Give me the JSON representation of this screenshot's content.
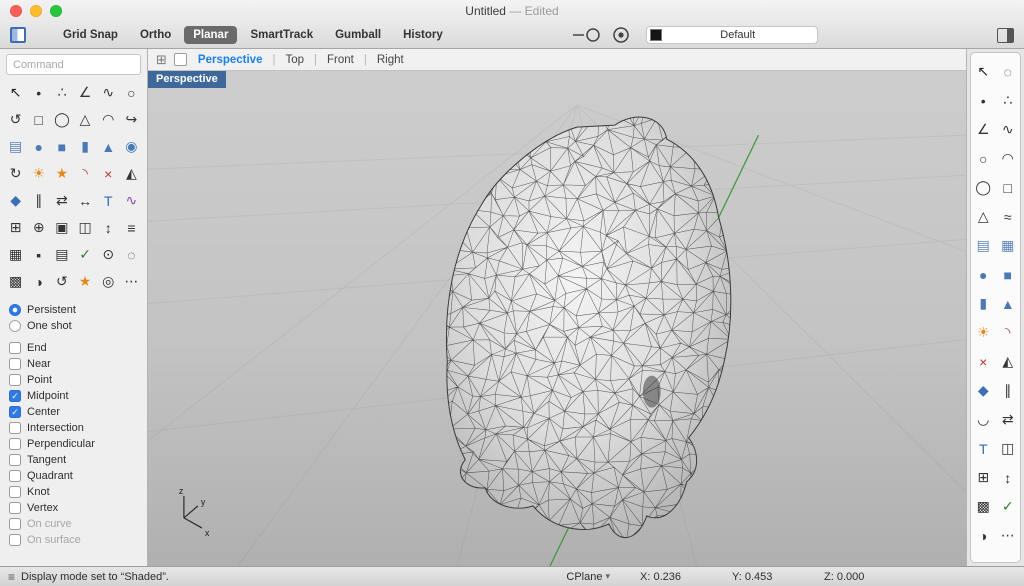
{
  "window": {
    "title": "Untitled",
    "edited": "— Edited",
    "traffic_colors": {
      "close": "#ff5f57",
      "minimize": "#febc2e",
      "zoom": "#2ac53e"
    }
  },
  "toolbar": {
    "buttons": [
      {
        "label": "Grid Snap",
        "active": false
      },
      {
        "label": "Ortho",
        "active": false
      },
      {
        "label": "Planar",
        "active": true
      },
      {
        "label": "SmartTrack",
        "active": false
      },
      {
        "label": "Gumball",
        "active": false
      },
      {
        "label": "History",
        "active": false
      }
    ],
    "widget_icons": [
      "osnap-widget-icon",
      "record-history-icon"
    ],
    "layer": {
      "name": "Default",
      "swatch_color": "#151515"
    }
  },
  "viewport_tabs": [
    {
      "label": "Perspective",
      "active": true
    },
    {
      "label": "Top",
      "active": false
    },
    {
      "label": "Front",
      "active": false
    },
    {
      "label": "Right",
      "active": false
    }
  ],
  "viewport": {
    "badge": "Perspective",
    "axis": {
      "x": "x",
      "y": "y",
      "z": "z"
    },
    "axis_line_color": "#3f9b3f",
    "mesh_stroke_color": "#2b2b2b"
  },
  "left_panel": {
    "command_placeholder": "Command",
    "tool_icons": [
      [
        "pointer-icon",
        "↖",
        "#222222"
      ],
      [
        "point-icon",
        "•",
        "#333333"
      ],
      [
        "points-icon",
        "∴",
        "#333333"
      ],
      [
        "polyline-icon",
        "∠",
        "#333333"
      ],
      [
        "curve-icon",
        "∿",
        "#333333"
      ],
      [
        "circle-icon",
        "○",
        "#333333"
      ],
      [
        "orbit-icon",
        "↺",
        "#333333"
      ],
      [
        "rectangle-icon",
        "□",
        "#333333"
      ],
      [
        "ellipse-icon",
        "◯",
        "#333333"
      ],
      [
        "polygon-icon",
        "△",
        "#333333"
      ],
      [
        "arc-icon",
        "◠",
        "#333333"
      ],
      [
        "extend-icon",
        "↪",
        "#333333"
      ],
      [
        "surface-icon",
        "▤",
        "#5b82b8"
      ],
      [
        "sphere-icon",
        "●",
        "#4a7ab5"
      ],
      [
        "box-icon",
        "■",
        "#4a7ab5"
      ],
      [
        "cylinder-icon",
        "▮",
        "#4a7ab5"
      ],
      [
        "cone-icon",
        "▲",
        "#4a7ab5"
      ],
      [
        "tube-icon",
        "◉",
        "#4a7ab5"
      ],
      [
        "revolve-icon",
        "↻",
        "#333333"
      ],
      [
        "spark-icon",
        "☀",
        "#e08a1e"
      ],
      [
        "explode-icon",
        "★",
        "#e08a1e"
      ],
      [
        "fillet-icon",
        "◝",
        "#b03a2e"
      ],
      [
        "trim-icon",
        "×",
        "#b03a2e"
      ],
      [
        "split-icon",
        "◭",
        "#333333"
      ],
      [
        "droplet-icon",
        "◆",
        "#3a6fb5"
      ],
      [
        "offset-icon",
        "∥",
        "#333333"
      ],
      [
        "swap-icon",
        "⇄",
        "#333333"
      ],
      [
        "scale-icon",
        "↔",
        "#333333"
      ],
      [
        "text-icon",
        "T",
        "#2e6db4"
      ],
      [
        "flow-icon",
        "∿",
        "#8e44ad"
      ],
      [
        "array-icon",
        "⊞",
        "#333333"
      ],
      [
        "polar-array-icon",
        "⊕",
        "#333333"
      ],
      [
        "copy-icon",
        "▣",
        "#333333"
      ],
      [
        "mirror-icon",
        "◫",
        "#333333"
      ],
      [
        "move-icon",
        "↕",
        "#333333"
      ],
      [
        "align-icon",
        "≡",
        "#333333"
      ],
      [
        "group-icon",
        "▦",
        "#333333"
      ],
      [
        "lock-icon",
        "▪",
        "#333333"
      ],
      [
        "layers-icon",
        "▤",
        "#333333"
      ],
      [
        "check-icon",
        "✓",
        "#2d7d2d"
      ],
      [
        "zoom-icon",
        "⊙",
        "#333333"
      ],
      [
        "hide-icon",
        "◌",
        "#333333"
      ],
      [
        "mesh-icon",
        "▩",
        "#333333"
      ],
      [
        "shade-icon",
        "◑",
        "#333333"
      ],
      [
        "spin-icon",
        "↺",
        "#333333"
      ],
      [
        "spark2-icon",
        "★",
        "#e08a1e"
      ],
      [
        "search-icon",
        "◎",
        "#333333"
      ],
      [
        "more-icon",
        "⋯",
        "#333333"
      ]
    ],
    "osnap_radios": [
      {
        "label": "Persistent",
        "selected": true
      },
      {
        "label": "One shot",
        "selected": false
      }
    ],
    "osnap_checkboxes": [
      {
        "label": "End",
        "checked": false,
        "disabled": false
      },
      {
        "label": "Near",
        "checked": false,
        "disabled": false
      },
      {
        "label": "Point",
        "checked": false,
        "disabled": false
      },
      {
        "label": "Midpoint",
        "checked": true,
        "disabled": false
      },
      {
        "label": "Center",
        "checked": true,
        "disabled": false
      },
      {
        "label": "Intersection",
        "checked": false,
        "disabled": false
      },
      {
        "label": "Perpendicular",
        "checked": false,
        "disabled": false
      },
      {
        "label": "Tangent",
        "checked": false,
        "disabled": false
      },
      {
        "label": "Quadrant",
        "checked": false,
        "disabled": false
      },
      {
        "label": "Knot",
        "checked": false,
        "disabled": false
      },
      {
        "label": "Vertex",
        "checked": false,
        "disabled": false
      },
      {
        "label": "On curve",
        "checked": false,
        "disabled": true
      },
      {
        "label": "On surface",
        "checked": false,
        "disabled": true
      }
    ]
  },
  "right_panel": {
    "tool_icons": [
      [
        "pointer-icon",
        "↖",
        "#222222"
      ],
      [
        "lasso-icon",
        "◌",
        "#333333"
      ],
      [
        "point-icon",
        "•",
        "#333333"
      ],
      [
        "points-icon",
        "∴",
        "#333333"
      ],
      [
        "polyline-icon",
        "∠",
        "#333333"
      ],
      [
        "curve-icon",
        "∿",
        "#333333"
      ],
      [
        "circle-icon",
        "○",
        "#333333"
      ],
      [
        "arc-icon",
        "◠",
        "#333333"
      ],
      [
        "ellipse-icon",
        "◯",
        "#333333"
      ],
      [
        "rectangle-icon",
        "□",
        "#333333"
      ],
      [
        "polygon-icon",
        "△",
        "#333333"
      ],
      [
        "freeform-icon",
        "≈",
        "#333333"
      ],
      [
        "surface-icon",
        "▤",
        "#5b82b8"
      ],
      [
        "loft-icon",
        "▦",
        "#5b82b8"
      ],
      [
        "sphere-icon",
        "●",
        "#4a7ab5"
      ],
      [
        "box-icon",
        "■",
        "#4a7ab5"
      ],
      [
        "cylinder-icon",
        "▮",
        "#4a7ab5"
      ],
      [
        "cone-icon",
        "▲",
        "#4a7ab5"
      ],
      [
        "spark-icon",
        "☀",
        "#e08a1e"
      ],
      [
        "fillet-icon",
        "◝",
        "#b03a2e"
      ],
      [
        "trim-icon",
        "×",
        "#b03a2e"
      ],
      [
        "split-icon",
        "◭",
        "#333333"
      ],
      [
        "droplet-icon",
        "◆",
        "#3a6fb5"
      ],
      [
        "offset-icon",
        "∥",
        "#333333"
      ],
      [
        "blend-icon",
        "◡",
        "#333333"
      ],
      [
        "swap-icon",
        "⇄",
        "#333333"
      ],
      [
        "text-icon",
        "T",
        "#2e6db4"
      ],
      [
        "mirror-icon",
        "◫",
        "#333333"
      ],
      [
        "array-icon",
        "⊞",
        "#333333"
      ],
      [
        "move-icon",
        "↕",
        "#333333"
      ],
      [
        "mesh-icon",
        "▩",
        "#333333"
      ],
      [
        "check-icon",
        "✓",
        "#2d7d2d"
      ],
      [
        "shade-icon",
        "◑",
        "#333333"
      ],
      [
        "more-icon",
        "⋯",
        "#333333"
      ]
    ]
  },
  "status_bar": {
    "message": "Display mode set to “Shaded”.",
    "cplane": "CPlane",
    "coords": {
      "x": "X: 0.236",
      "y": "Y: 0.453",
      "z": "Z: 0.000"
    }
  },
  "icons": {
    "checkbox_check": "✓",
    "status_grid": "≡",
    "cplane_caret": "▾",
    "tab_layout_glyph": "⊞"
  }
}
